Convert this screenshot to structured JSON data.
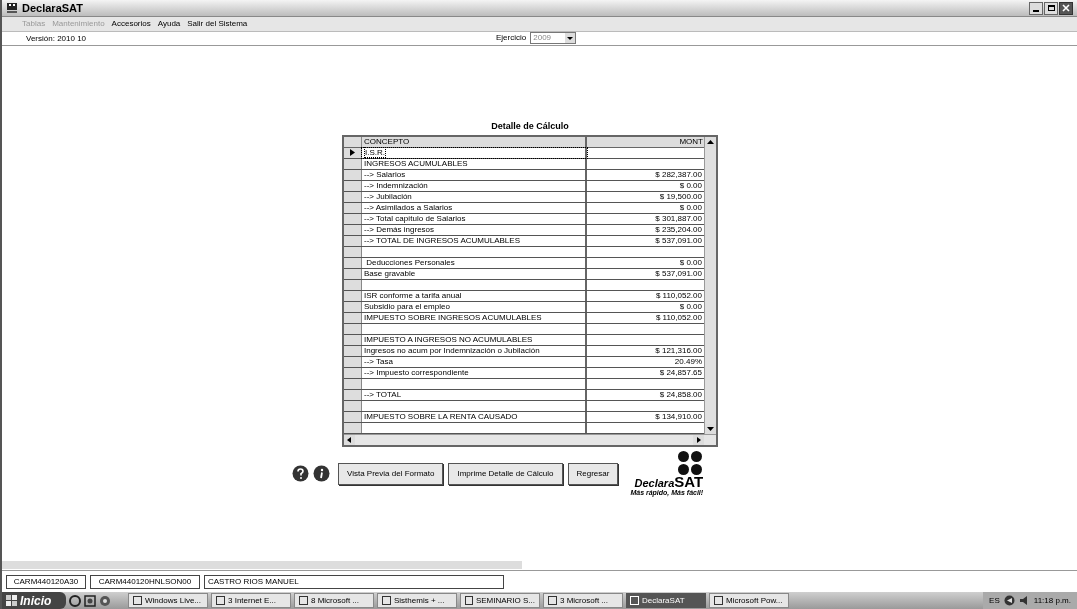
{
  "window": {
    "title": "DeclaraSAT"
  },
  "menu": [
    {
      "label": "Tablas",
      "disabled": true
    },
    {
      "label": "Mantenimiento",
      "disabled": true
    },
    {
      "label": "Accesorios",
      "disabled": false
    },
    {
      "label": "Ayuda",
      "disabled": false
    },
    {
      "label": "Salir del Sistema",
      "disabled": false
    }
  ],
  "version": "Versión: 2010 10",
  "ejercicio": {
    "label": "Ejercicio",
    "value": "2009"
  },
  "grid": {
    "title": "Detalle de Cálculo",
    "columns": [
      "CONCEPTO",
      "MONT"
    ],
    "rows": [
      {
        "concepto": "I.S.R.",
        "monto": "",
        "selected": true
      },
      {
        "concepto": "INGRESOS ACUMULABLES",
        "monto": "",
        "selected": false
      },
      {
        "concepto": "--> Salarios",
        "monto": "$ 282,387.00",
        "selected": false
      },
      {
        "concepto": "--> Indemnización",
        "monto": "$ 0.00",
        "selected": false
      },
      {
        "concepto": "--> Jubilación",
        "monto": "$ 19,500.00",
        "selected": false
      },
      {
        "concepto": "--> Asimilados a Salarios",
        "monto": "$ 0.00",
        "selected": false
      },
      {
        "concepto": "--> Total capítulo de Salarios",
        "monto": "$ 301,887.00",
        "selected": false
      },
      {
        "concepto": "--> Demás ingresos",
        "monto": "$ 235,204.00",
        "selected": false
      },
      {
        "concepto": "--> TOTAL DE INGRESOS ACUMULABLES",
        "monto": "$ 537,091.00",
        "selected": false
      },
      {
        "concepto": "",
        "monto": "",
        "selected": false
      },
      {
        "concepto": " Deducciones Personales",
        "monto": "$ 0.00",
        "selected": false
      },
      {
        "concepto": "Base gravable",
        "monto": "$ 537,091.00",
        "selected": false
      },
      {
        "concepto": "",
        "monto": "",
        "selected": false
      },
      {
        "concepto": "ISR conforme a tarifa anual",
        "monto": "$ 110,052.00",
        "selected": false
      },
      {
        "concepto": "Subsidio para el empleo",
        "monto": "$ 0.00",
        "selected": false
      },
      {
        "concepto": "IMPUESTO SOBRE INGRESOS ACUMULABLES",
        "monto": "$ 110,052.00",
        "selected": false
      },
      {
        "concepto": "",
        "monto": "",
        "selected": false
      },
      {
        "concepto": "IMPUESTO A INGRESOS NO ACUMULABLES",
        "monto": "",
        "selected": false
      },
      {
        "concepto": "Ingresos no acum por Indemnización o Jubilación",
        "monto": "$ 121,316.00",
        "selected": false
      },
      {
        "concepto": "--> Tasa",
        "monto": "20.49%",
        "selected": false
      },
      {
        "concepto": "--> Impuesto correspondiente",
        "monto": "$ 24,857.65",
        "selected": false
      },
      {
        "concepto": "",
        "monto": "",
        "selected": false
      },
      {
        "concepto": "--> TOTAL",
        "monto": "$ 24,858.00",
        "selected": false
      },
      {
        "concepto": "",
        "monto": "",
        "selected": false
      },
      {
        "concepto": "IMPUESTO SOBRE LA RENTA CAUSADO",
        "monto": "$ 134,910.00",
        "selected": false
      },
      {
        "concepto": "",
        "monto": "",
        "selected": false
      }
    ]
  },
  "buttons": [
    "Vista Previa del Formato",
    "Imprime Detalle de Cálculo",
    "Regresar"
  ],
  "logo": {
    "name_a": "Declara",
    "name_b": "SAT",
    "slogan": "Más rápido, Más fácil!"
  },
  "status_fields": [
    "CARM440120A30",
    "CARM440120HNLSON00",
    "CASTRO RIOS MANUEL"
  ],
  "taskbar": {
    "start": "Inicio",
    "items": [
      {
        "label": "Windows Live...",
        "selected": false
      },
      {
        "label": "3 Internet E...",
        "selected": false
      },
      {
        "label": "8 Microsoft ...",
        "selected": false
      },
      {
        "label": "Sisthemis + ...",
        "selected": false
      },
      {
        "label": "SEMINARIO S...",
        "selected": false
      },
      {
        "label": "3 Microsoft ...",
        "selected": false
      },
      {
        "label": "DeclaraSAT",
        "selected": true
      },
      {
        "label": "Microsoft Pow...",
        "selected": false
      }
    ],
    "language": "ES",
    "clock": "11:18 p.m."
  }
}
